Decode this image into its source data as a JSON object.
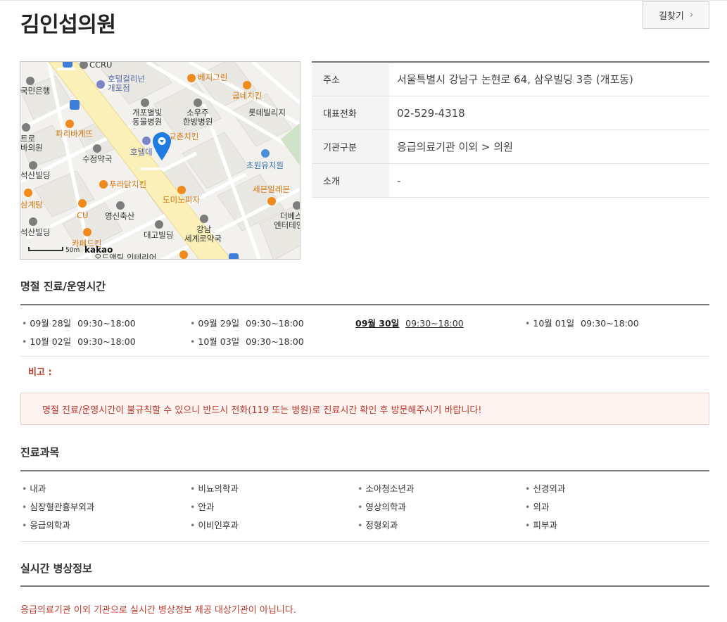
{
  "header": {
    "title": "김인섭의원",
    "directions_label": "길찾기"
  },
  "map": {
    "labels": {
      "ccru": "CCRU",
      "gukmin": "국민은행",
      "hotel_collina_1": "호텔컬리넌",
      "hotel_collina_2": "개포점",
      "vegegreen": "베지그린",
      "gubne": "굽네치킨",
      "gaepo_vet_1": "개포별빛",
      "gaepo_vet_2": "동물병원",
      "soujoo_1": "소우주",
      "soujoo_2": "한방병원",
      "lotte": "롯데빌리지",
      "paris": "파리바게뜨",
      "kyochon": "교촌치킨",
      "sujeong": "수정약국",
      "hotel_d": "호텔데",
      "chowon": "초원유치원",
      "trol_1": "트로",
      "trol_2": "바의원",
      "seoksan1": "석산빌딩",
      "pradak": "푸라닭치킨",
      "seven": "세븐일레븐",
      "samgyetang": "삼계탕",
      "domino": "도미노피자",
      "cu": "CU",
      "youngsin": "영신축산",
      "debest_1": "더베스",
      "debest_2": "엔터테인",
      "seoksan2": "석산빌딩",
      "daego": "대고빌딩",
      "gangnam_1": "강남",
      "gangnam_2": "세계로약국",
      "cafe": "카페드킨",
      "bottom": "오드앤틱 인테리어",
      "scale": "50m",
      "logo": "kakao"
    }
  },
  "info": {
    "rows": [
      {
        "key": "주소",
        "value": "서울특별시 강남구 논현로 64, 삼우빌딩 3층 (개포동)"
      },
      {
        "key": "대표전화",
        "value": "02-529-4318"
      },
      {
        "key": "기관구분",
        "value": "응급의료기관 이외 > 의원"
      },
      {
        "key": "소개",
        "value": "-"
      }
    ]
  },
  "holiday": {
    "title": "명절 진료/운영시간",
    "items": [
      {
        "date": "09월 28일",
        "time": "09:30~18:00",
        "today": false
      },
      {
        "date": "09월 29일",
        "time": "09:30~18:00",
        "today": false
      },
      {
        "date": "09월 30일",
        "time": "09:30~18:00",
        "today": true
      },
      {
        "date": "10월 01일",
        "time": "09:30~18:00",
        "today": false
      },
      {
        "date": "10월 02일",
        "time": "09:30~18:00",
        "today": false
      },
      {
        "date": "10월 03일",
        "time": "09:30~18:00",
        "today": false
      }
    ],
    "remark_label": "비고 :",
    "notice": "명절 진료/운영시간이 불규칙할 수 있으니 반드시 전화(119 또는 병원)로 진료시간 확인 후 방문해주시기 바랍니다!"
  },
  "departments": {
    "title": "진료과목",
    "items": [
      "내과",
      "비뇨의학과",
      "소아청소년과",
      "신경외과",
      "심장혈관흉부외과",
      "안과",
      "영상의학과",
      "외과",
      "응급의학과",
      "이비인후과",
      "정형외과",
      "피부과"
    ]
  },
  "realtime": {
    "title": "실시간 병상정보",
    "message": "응급의료기관 이외 기관으로 실시간 병상정보 제공 대상기관이 아닙니다."
  },
  "colors": {
    "notice_text": "#c0392b",
    "notice_bg": "#fdf3f0",
    "marker": "#1e7be0",
    "road": "#fbf0b8"
  }
}
